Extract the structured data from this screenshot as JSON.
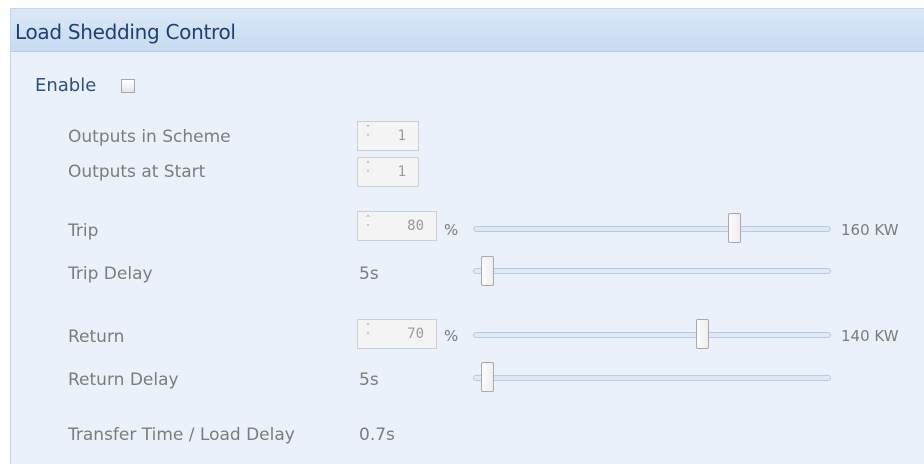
{
  "panel": {
    "title": "Load Shedding Control"
  },
  "enable": {
    "label": "Enable",
    "checked": false
  },
  "outputs_in_scheme": {
    "label": "Outputs in Scheme",
    "value": "1"
  },
  "outputs_at_start": {
    "label": "Outputs at Start",
    "value": "1"
  },
  "trip": {
    "label": "Trip",
    "value": "80",
    "unit": "%",
    "kw": "160 KW",
    "slider_fraction": 0.73
  },
  "trip_delay": {
    "label": "Trip Delay",
    "value": "5s",
    "slider_fraction": 0.04
  },
  "return": {
    "label": "Return",
    "value": "70",
    "unit": "%",
    "kw": "140 KW",
    "slider_fraction": 0.64
  },
  "return_delay": {
    "label": "Return Delay",
    "value": "5s",
    "slider_fraction": 0.04
  },
  "transfer": {
    "label": "Transfer Time / Load Delay",
    "value": "0.7s"
  },
  "spinner_arrows": {
    "up": "˄",
    "down": "˅"
  }
}
